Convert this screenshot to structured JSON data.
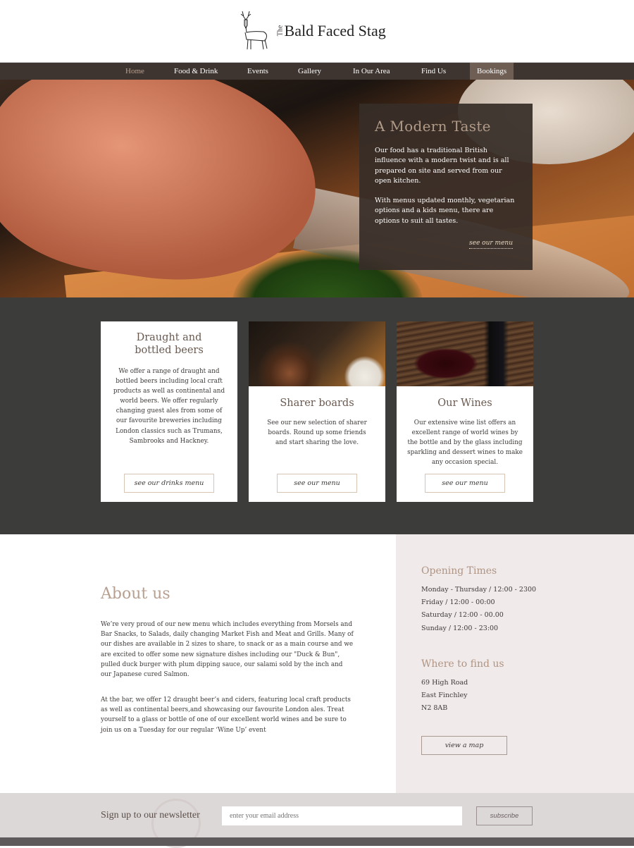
{
  "brand": {
    "the": "The",
    "name": "Bald Faced Stag"
  },
  "nav": [
    {
      "label": "Home"
    },
    {
      "label": "Food & Drink"
    },
    {
      "label": "Events"
    },
    {
      "label": "Gallery"
    },
    {
      "label": "In Our Area"
    },
    {
      "label": "Find Us"
    },
    {
      "label": "Bookings"
    }
  ],
  "hero": {
    "title": "A Modern Taste",
    "p1": "Our food has a traditional British influence with a modern twist and is all prepared on site and served from our open kitchen.",
    "p2": "With menus updated monthly, vegetarian options and a kids menu, there are options to suit all tastes.",
    "link": "see our menu"
  },
  "cards": [
    {
      "title": "Draught and bottled beers",
      "text": "We offer a range of draught and bottled beers including local craft products as well as continental and world beers. We offer regularly changing guest ales from some of our favourite breweries including London classics such as Trumans, Sambrooks and Hackney.",
      "button": "see our drinks menu"
    },
    {
      "title": "Sharer boards",
      "text": "See our new selection of sharer boards. Round up some friends and start sharing the love.",
      "button": "see our menu"
    },
    {
      "title": "Our Wines",
      "text": "Our extensive wine list offers an excellent range of world wines by the bottle and by the glass including sparkling and dessert wines to make any occasion special.",
      "button": "see our menu"
    }
  ],
  "about": {
    "title": "About us",
    "p1": "We’re very proud of our new menu which includes everything from Morsels and Bar Snacks, to Salads, daily changing Market Fish and Meat and Grills. Many of our dishes are available in 2 sizes to share, to snack or as a main course and we are excited to offer some new signature dishes including our \"Duck & Bun\", pulled duck burger with plum dipping sauce, our salami sold by the inch and our Japanese cured Salmon.",
    "p2": "At the bar, we offer 12 draught beer’s and ciders, featuring local craft products as well as continental beers,and showcasing our favourite London ales. Treat yourself to a glass or bottle of one of our excellent world wines and be sure to join us on a Tuesday for our regular ‘Wine Up’ event"
  },
  "opening": {
    "title": "Opening Times",
    "lines": [
      "Monday - Thursday / 12:00 - 2300",
      "Friday / 12:00 - 00:00",
      "Saturday / 12:00 - 00.00",
      "Sunday / 12:00 - 23:00"
    ]
  },
  "location": {
    "title": "Where to find us",
    "lines": [
      "69 High Road",
      "East Finchley",
      "N2 8AB"
    ],
    "button": "view a map"
  },
  "newsletter": {
    "label": "Sign up to our newsletter",
    "placeholder": "enter your email address",
    "button": "subscribe"
  }
}
